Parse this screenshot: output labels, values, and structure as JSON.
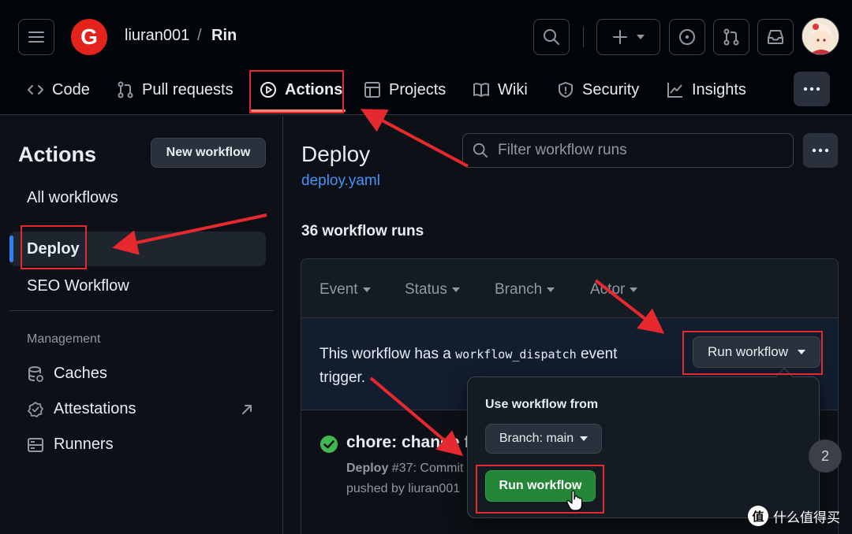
{
  "header": {
    "owner": "liuran001",
    "separator": "/",
    "repo": "Rin",
    "logo_letter": "G",
    "brand_color": "#e4231c"
  },
  "tabs": [
    {
      "label": "Code",
      "icon": "code-icon"
    },
    {
      "label": "Pull requests",
      "icon": "git-pull-request-icon"
    },
    {
      "label": "Actions",
      "icon": "play-icon",
      "active": true
    },
    {
      "label": "Projects",
      "icon": "table-icon"
    },
    {
      "label": "Wiki",
      "icon": "book-icon"
    },
    {
      "label": "Security",
      "icon": "shield-icon"
    },
    {
      "label": "Insights",
      "icon": "graph-icon"
    }
  ],
  "sidebar": {
    "title": "Actions",
    "new_workflow": "New workflow",
    "items": [
      "All workflows",
      "Deploy",
      "SEO Workflow"
    ],
    "active_item": "Deploy",
    "management_label": "Management",
    "management": [
      "Caches",
      "Attestations",
      "Runners"
    ]
  },
  "main": {
    "title": "Deploy",
    "file": "deploy.yaml",
    "filter_placeholder": "Filter workflow runs",
    "runs_count": "36 workflow runs",
    "filters": [
      "Event",
      "Status",
      "Branch",
      "Actor"
    ],
    "dispatch_prefix": "This workflow has a",
    "dispatch_code": "workflow_dispatch",
    "dispatch_suffix": "event trigger.",
    "run_workflow_label": "Run workflow",
    "run": {
      "title": "chore: change f",
      "workflow": "Deploy",
      "meta": "#37: Commit",
      "pushed_by": "pushed by liuran001"
    }
  },
  "popover": {
    "label": "Use workflow from",
    "branch": "Branch: main",
    "run_button": "Run workflow"
  },
  "overlay": {
    "page_badge": "2",
    "watermark": "什么值得买",
    "watermark_logo": "值",
    "annotation_color": "#e5292e"
  }
}
